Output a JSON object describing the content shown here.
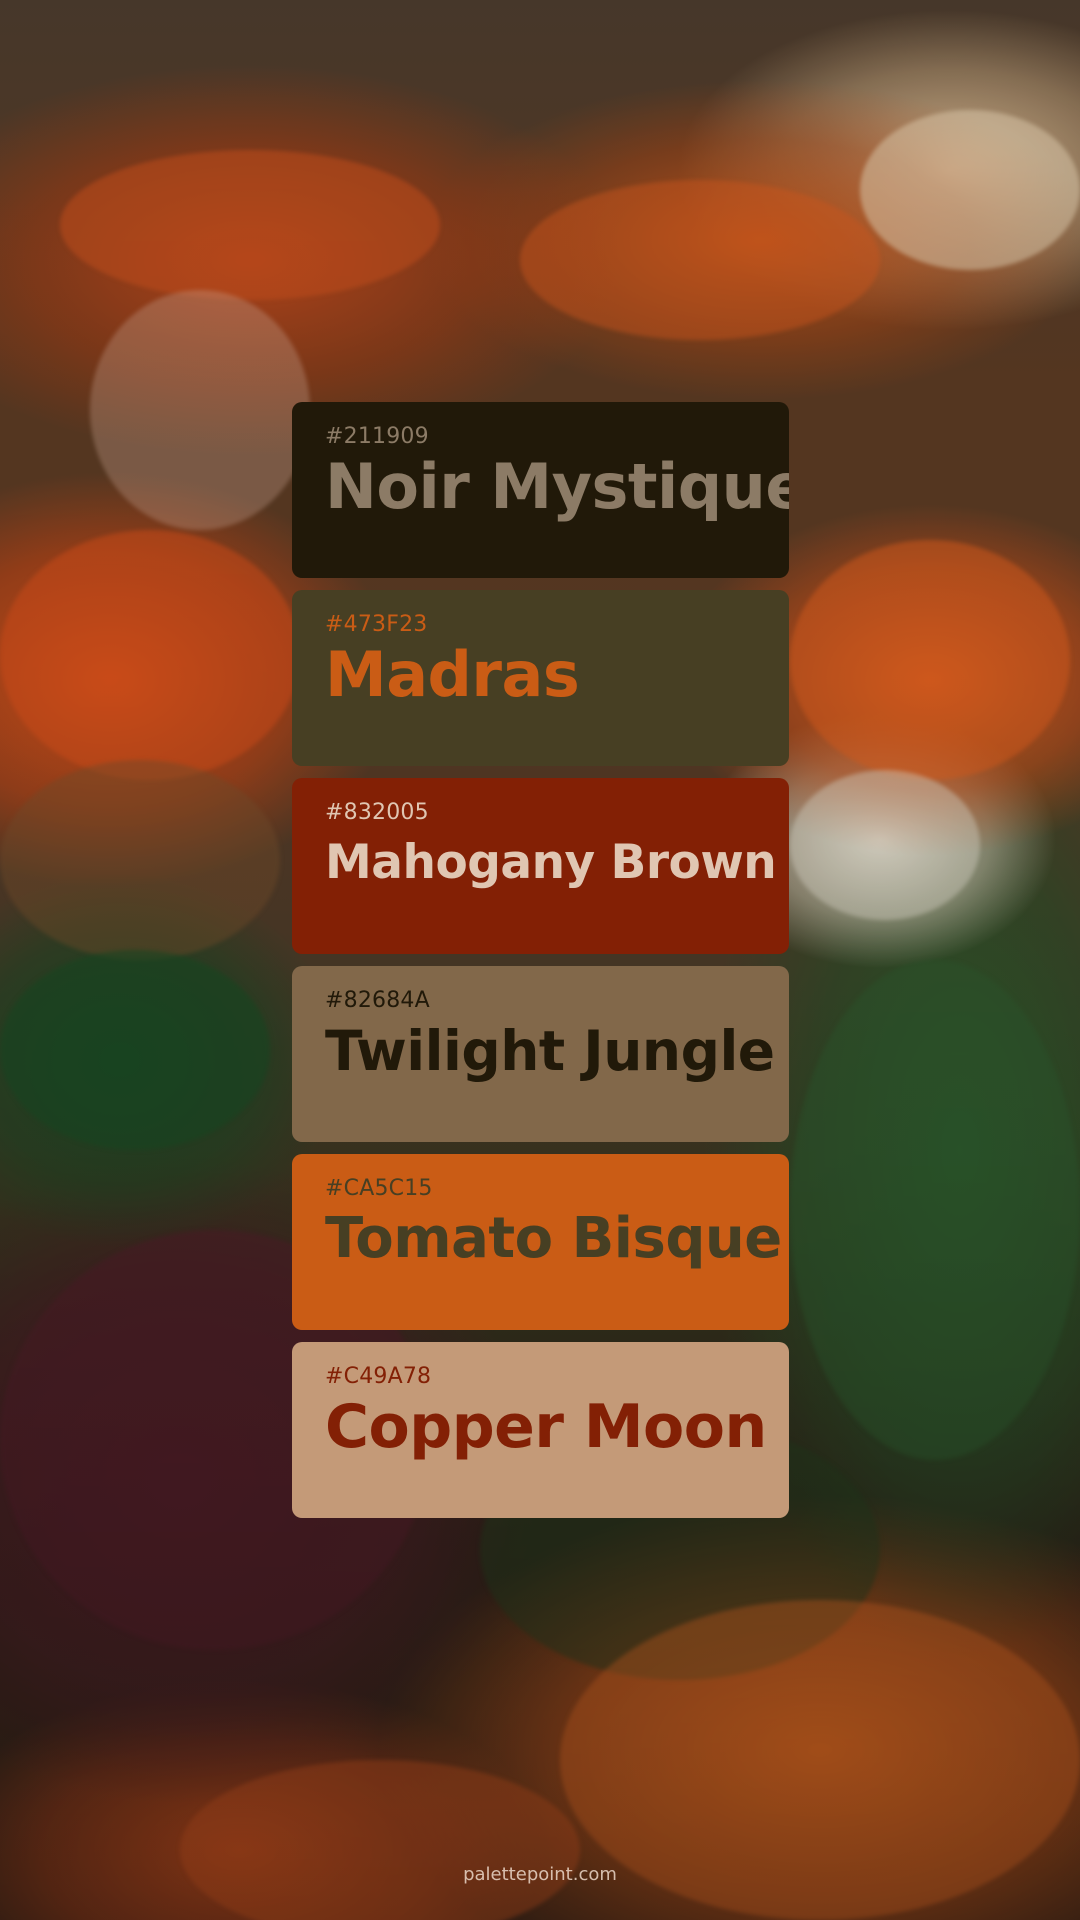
{
  "palette": {
    "colors": [
      {
        "hex": "#211909",
        "name": "Noir Mystique",
        "background": "#211909",
        "hex_color": "#8c7b66",
        "name_color": "#8c7b66"
      },
      {
        "hex": "#473F23",
        "name": "Madras",
        "background": "#473F23",
        "hex_color": "#CA5C15",
        "name_color": "#CA5C15"
      },
      {
        "hex": "#832005",
        "name": "Mahogany Brown",
        "background": "#832005",
        "hex_color": "#e0c6b2",
        "name_color": "#e0c6b2"
      },
      {
        "hex": "#82684A",
        "name": "Twilight Jungle",
        "background": "#82684A",
        "hex_color": "#211909",
        "name_color": "#211909"
      },
      {
        "hex": "#CA5C15",
        "name": "Tomato Bisque",
        "background": "#CA5C15",
        "hex_color": "#473F23",
        "name_color": "#473F23"
      },
      {
        "hex": "#C49A78",
        "name": "Copper Moon",
        "background": "#C49A78",
        "hex_color": "#832005",
        "name_color": "#832005"
      }
    ]
  },
  "footer": {
    "site": "palettepoint.com"
  }
}
